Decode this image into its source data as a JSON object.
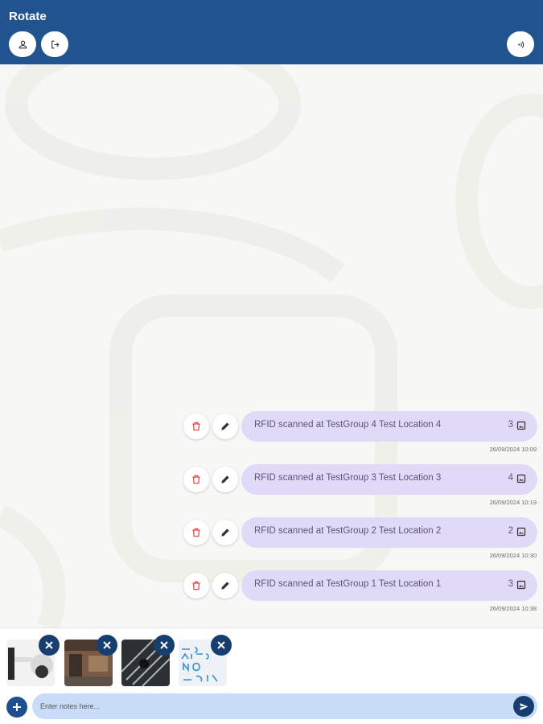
{
  "app": {
    "title": "Rotate"
  },
  "header": {
    "buttons": [
      {
        "icon": "person-icon"
      },
      {
        "icon": "logout-icon"
      },
      {
        "icon": "nfc-icon"
      }
    ]
  },
  "messages": [
    {
      "text": "RFID scanned at TestGroup 4 Test Location 4",
      "count": "3",
      "timestamp": "26/09/2024 10:09"
    },
    {
      "text": "RFID scanned at TestGroup 3 Test Location 3",
      "count": "4",
      "timestamp": "26/09/2024 10:19"
    },
    {
      "text": "RFID scanned at TestGroup 2 Test Location 2",
      "count": "2",
      "timestamp": "26/09/2024 10:30"
    },
    {
      "text": "RFID scanned at TestGroup 1 Test Location 1",
      "count": "3",
      "timestamp": "26/09/2024 10:38"
    }
  ],
  "attachments": [
    {
      "name": "camera-photo",
      "remove_icon": "close-icon"
    },
    {
      "name": "building-photo",
      "remove_icon": "close-icon"
    },
    {
      "name": "railing-photo",
      "remove_icon": "close-icon"
    },
    {
      "name": "handwriting-photo",
      "handwritten": "BORDER NO ENTRY",
      "remove_icon": "close-icon"
    }
  ],
  "composer": {
    "placeholder": "Enter notes here...",
    "add_icon": "plus-icon",
    "send_icon": "send-icon"
  },
  "colors": {
    "header": "#21538f",
    "bubble": "#e0daf8",
    "delete": "#e53935",
    "dark_button": "#163e6f",
    "notes_field": "#c9dcf7"
  }
}
